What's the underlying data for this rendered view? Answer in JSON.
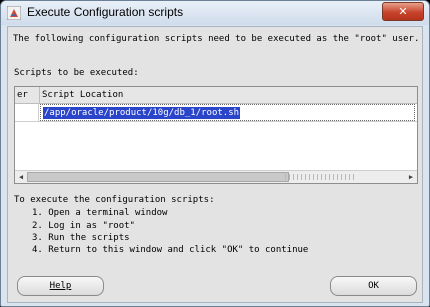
{
  "window": {
    "title": "Execute Configuration scripts"
  },
  "intro_text": "The following configuration scripts need to be executed as the \"root\" user.",
  "scripts_label": "Scripts to be executed:",
  "table": {
    "columns": [
      "er",
      "Script Location"
    ],
    "rows": [
      {
        "er": "",
        "location": "/app/oracle/product/10g/db_1/root.sh"
      }
    ]
  },
  "instructions": {
    "heading": "To execute the configuration scripts:",
    "steps": [
      "1. Open a terminal window",
      "2. Log in as \"root\"",
      "3. Run the scripts",
      "4. Return to this window and click \"OK\" to continue"
    ]
  },
  "buttons": {
    "help": "Help",
    "ok": "OK"
  }
}
